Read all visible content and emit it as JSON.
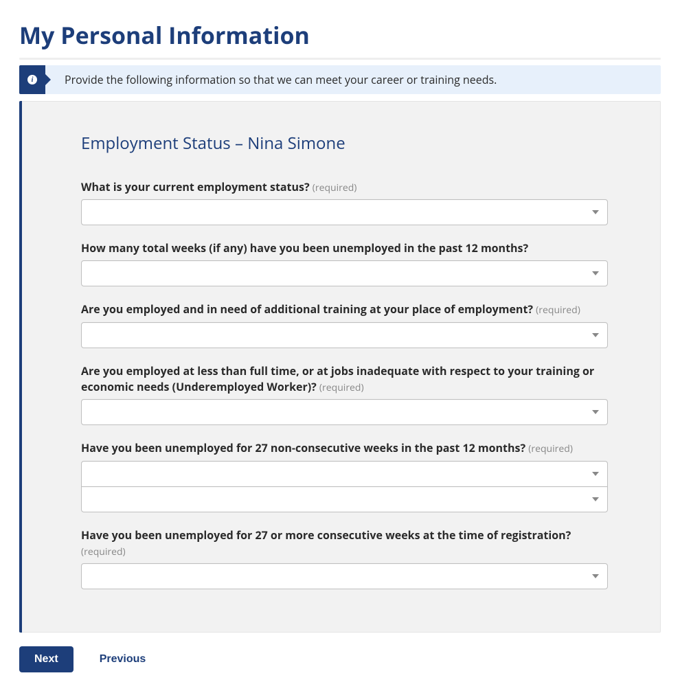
{
  "header": {
    "title": "My Personal Information",
    "banner": "Provide the following information so that we can meet your career or training needs."
  },
  "section": {
    "title": "Employment Status – Nina Simone"
  },
  "required_text": "(required)",
  "fields": {
    "status": {
      "label": "What is your current employment status?",
      "required": true,
      "value": ""
    },
    "weeks_total": {
      "label": "How many total weeks (if any) have you been unemployed in the past 12 months?",
      "required": false,
      "value": ""
    },
    "training": {
      "label": "Are you employed and in need of additional training at your place of employment?",
      "required": true,
      "value": ""
    },
    "underemployed": {
      "label": "Are you employed at less than full time, or at jobs inadequate with respect to your training or economic needs (Underemployed Worker)?",
      "required": true,
      "value": ""
    },
    "nonconsec27": {
      "label": "Have you been unemployed for 27 non-consecutive weeks in the past 12 months?",
      "required": true,
      "value1": "",
      "value2": ""
    },
    "consec27": {
      "label": "Have you been unemployed for 27 or more consecutive weeks at the time of registration?",
      "required": true,
      "value": ""
    }
  },
  "buttons": {
    "next": "Next",
    "previous": "Previous"
  }
}
